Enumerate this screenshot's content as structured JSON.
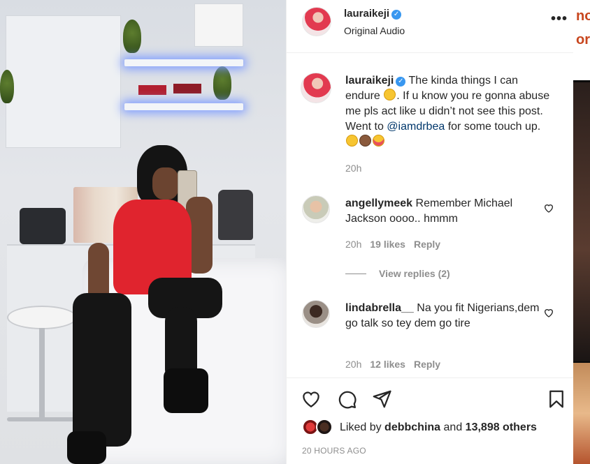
{
  "post": {
    "username": "lauraikeji",
    "audio_label": "Original Audio",
    "more_icon": "more-horizontal-icon"
  },
  "caption": {
    "username": "lauraikeji",
    "text_part1": "The kinda things I can endure",
    "text_part2": ". If u know you re gonna abuse me pls act like u didn’t not see this post. Went to",
    "mention": "@iamdrbea",
    "text_part3": "for some touch up.",
    "time": "20h"
  },
  "comments": [
    {
      "username": "angellymeek",
      "text": "Remember Michael Jackson oooo.. hmmm",
      "time": "20h",
      "likes": "19 likes",
      "reply_label": "Reply",
      "view_replies": "View replies (2)"
    },
    {
      "username": "lindabrella__",
      "text": "Na you fit Nigerians,dem go talk so tey dem go tire",
      "time": "20h",
      "likes": "12 likes",
      "reply_label": "Reply"
    }
  ],
  "actions": {
    "icons": [
      "heart-icon",
      "comment-icon",
      "share-icon",
      "bookmark-icon"
    ],
    "liked_by_prefix": "Liked by",
    "liked_by_user": "debbchina",
    "liked_by_and": "and",
    "liked_by_count": "13,898 others",
    "timestamp": "20 HOURS AGO"
  },
  "side_strip": {
    "text_top": "no",
    "text_mid": "or"
  },
  "colors": {
    "text": "#262626",
    "muted": "#8e8e8e",
    "verified": "#3897f0",
    "mention": "#00376b",
    "border": "#efefef"
  }
}
